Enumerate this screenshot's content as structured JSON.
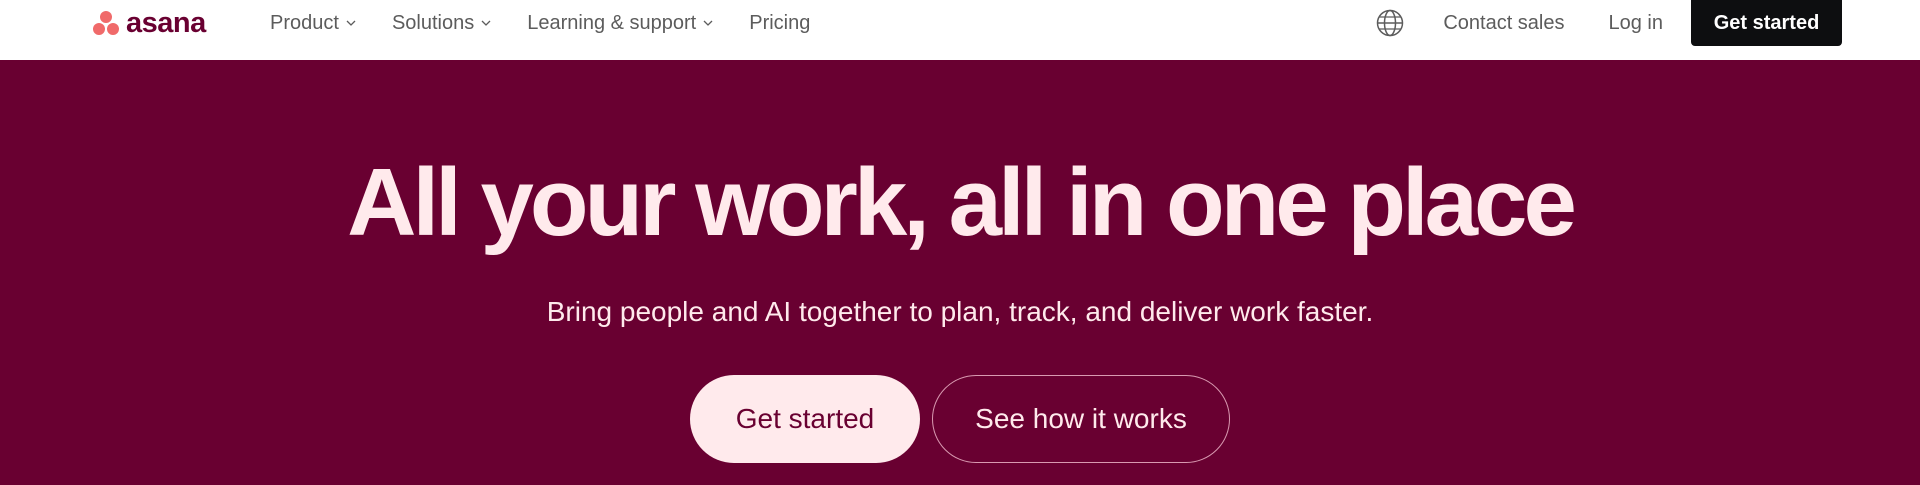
{
  "brand": {
    "name": "asana",
    "logo_icon": "asana-dots-logo",
    "colors": {
      "mark": "#f06a6a",
      "wordmark": "#690031"
    }
  },
  "nav": {
    "items": [
      {
        "label": "Product",
        "has_dropdown": true
      },
      {
        "label": "Solutions",
        "has_dropdown": true
      },
      {
        "label": "Learning & support",
        "has_dropdown": true
      },
      {
        "label": "Pricing",
        "has_dropdown": false
      }
    ],
    "right": {
      "language_icon": "globe-icon",
      "contact_sales": "Contact sales",
      "log_in": "Log in",
      "get_started": "Get started"
    }
  },
  "hero": {
    "title": "All your work, all in one place",
    "subtitle": "Bring people and AI together to plan, track, and deliver work faster.",
    "primary_cta": "Get started",
    "secondary_cta": "See how it works",
    "colors": {
      "background": "#690031",
      "text": "#ffeaec",
      "top_cta_bg": "#0d0e10"
    }
  }
}
